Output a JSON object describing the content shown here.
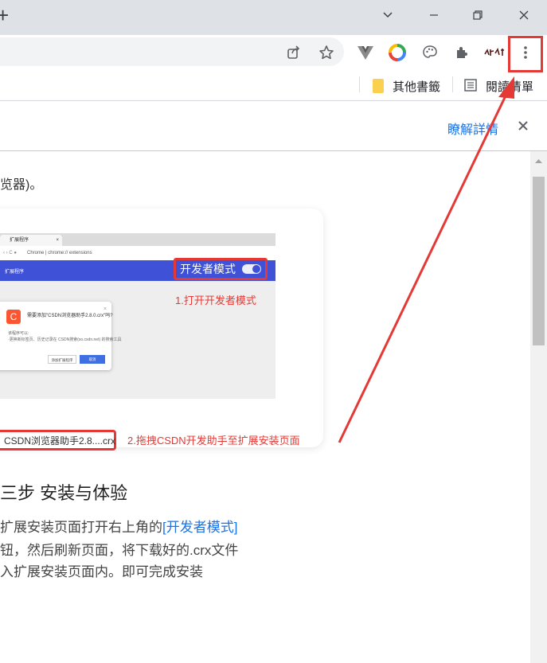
{
  "browser": {
    "tabstrip": {
      "new_tab_icon": "plus-icon",
      "controls": [
        "chevron-down-icon",
        "minimize-icon",
        "restore-icon",
        "close-icon"
      ]
    },
    "toolbar": {
      "icons": [
        "share-icon",
        "star-icon",
        "vue-devtools-icon",
        "chrome-circle-icon",
        "palette-icon",
        "puzzle-extensions-icon",
        "calligraphy-extension-icon",
        "three-dots-menu-icon"
      ]
    },
    "bookmarks": {
      "other_bookmarks": "其他書籤",
      "reading_list": "閱讀清單"
    },
    "infobar": {
      "learn_more": "瞭解詳情"
    }
  },
  "article": {
    "fragment_top": "览器)。",
    "screenshot": {
      "mock_tab": "扩展程序",
      "mock_address_prefix": "Chrome",
      "mock_address_path": "| chrome:// extensions",
      "mock_header": "扩展程序",
      "devmode_label": "开发者模式",
      "step1": "1.打开开发者模式",
      "dialog_title": "需要添加\"CSDN浏览器助手2.8.0.crx\"吗?",
      "dialog_perm_title": "该程序可以:",
      "dialog_perm_line": "·更换新标签页、历史记录在 CSDN搜索(so.csdn.net) 的搜索工具",
      "dialog_cancel": "添加扩展程序",
      "dialog_add": "取消",
      "crx_file": "CSDN浏览器助手2.8....crx",
      "step2": "2.拖拽CSDN开发助手至扩展安装页面"
    },
    "step3_heading": "三步 安装与体验",
    "para_line1_prefix": "扩展安装页面打开右上角的",
    "para_line1_link": "[开发者模式]",
    "para_line2": "钮，然后刷新页面，将下载好的.crx文件",
    "para_line3": "入扩展安装页面内。即可完成安装"
  },
  "colors": {
    "annotation_red": "#e53935",
    "link_blue": "#1a73e8",
    "mock_header_blue": "#3f51d6"
  }
}
